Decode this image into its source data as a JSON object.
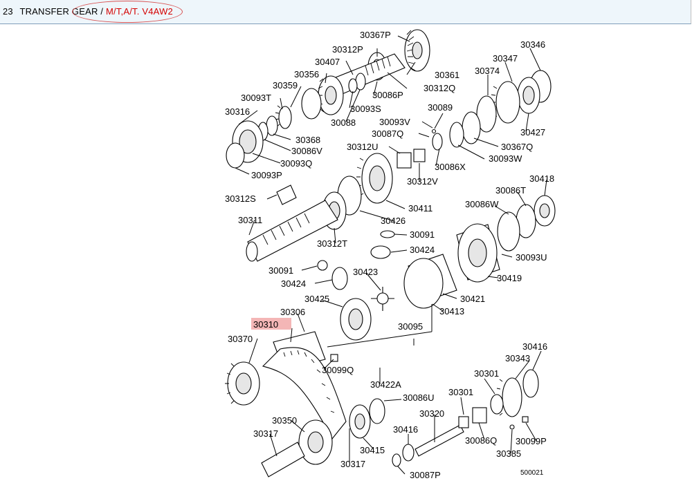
{
  "header": {
    "number": "23",
    "title": "TRANSFER GEAR",
    "separator": "/",
    "model": "M/T,A/T. V4AW2"
  },
  "diagram": {
    "reference": "500021",
    "highlighted_part": "30310",
    "parts": {
      "p30367P": "30367P",
      "p30312P": "30312P",
      "p30407": "30407",
      "p30356": "30356",
      "p30359": "30359",
      "p30093T": "30093T",
      "p30316": "30316",
      "p30361": "30361",
      "p30312Q": "30312Q",
      "p30086P": "30086P",
      "p30093S": "30093S",
      "p30088": "30088",
      "p30368": "30368",
      "p30086V": "30086V",
      "p30093Q": "30093Q",
      "p30093P": "30093P",
      "p30346": "30346",
      "p30347": "30347",
      "p30374": "30374",
      "p30427": "30427",
      "p30089": "30089",
      "p30093V": "30093V",
      "p30087Q": "30087Q",
      "p30367Q": "30367Q",
      "p30093W": "30093W",
      "p30312U": "30312U",
      "p30086X": "30086X",
      "p30312V": "30312V",
      "p30312S": "30312S",
      "p30411": "30411",
      "p30311": "30311",
      "p30426": "30426",
      "p30312T": "30312T",
      "p30418": "30418",
      "p30086T": "30086T",
      "p30086W": "30086W",
      "p30091a": "30091",
      "p30424a": "30424",
      "p30093U": "30093U",
      "p30091b": "30091",
      "p30424b": "30424",
      "p30423": "30423",
      "p30419": "30419",
      "p30425": "30425",
      "p30421": "30421",
      "p30413": "30413",
      "p30306": "30306",
      "p30310": "30310",
      "p30095": "30095",
      "p30370": "30370",
      "p30099Q": "30099Q",
      "p30416a": "30416",
      "p30343": "30343",
      "p30422A": "30422A",
      "p30301a": "30301",
      "p30086U": "30086U",
      "p30301b": "30301",
      "p30320": "30320",
      "p30350": "30350",
      "p30317a": "30317",
      "p30416b": "30416",
      "p30415": "30415",
      "p30086Q": "30086Q",
      "p30099P": "30099P",
      "p30385": "30385",
      "p30317b": "30317",
      "p30087P": "30087P"
    }
  }
}
